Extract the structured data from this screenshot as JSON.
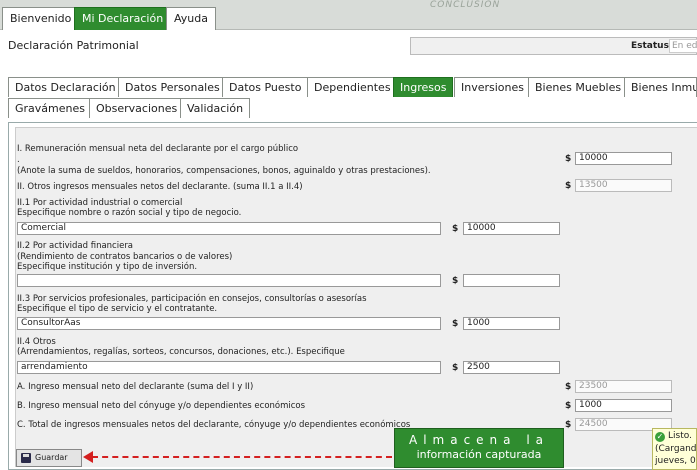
{
  "main_tabs": [
    {
      "label": "Bienvenido"
    },
    {
      "label": "Mi Declaración"
    },
    {
      "label": "Ayuda"
    }
  ],
  "header_deco": "CONCLUSIÓN",
  "page_title": "Declaración Patrimonial",
  "estatus": {
    "label": "Estatus",
    "value": "En edición"
  },
  "section_tabs": [
    {
      "label": "Datos Declaración"
    },
    {
      "label": "Datos Personales"
    },
    {
      "label": "Datos Puesto"
    },
    {
      "label": "Dependientes"
    },
    {
      "label": "Ingresos"
    },
    {
      "label": "Inversiones"
    },
    {
      "label": "Bienes Muebles"
    },
    {
      "label": "Bienes Inmuebles"
    },
    {
      "label": "Gravámenes"
    },
    {
      "label": "Observaciones"
    },
    {
      "label": "Validación"
    }
  ],
  "currency_symbol": "$",
  "form": {
    "I": {
      "label1": "I. Remuneración mensual neta del declarante por el cargo público",
      "label2": ".",
      "label3": "(Anote la suma de sueldos, honorarios, compensaciones, bonos, aguinaldo y otras prestaciones).",
      "value": "10000"
    },
    "II": {
      "label": "II. Otros ingresos mensuales netos del declarante. (suma II.1 a II.4)",
      "value": "13500"
    },
    "II1": {
      "label1": "II.1 Por actividad industrial o comercial",
      "label2": "Especifique nombre o razón social y tipo de negocio.",
      "text": "Comercial",
      "value": "10000"
    },
    "II2": {
      "label1": "II.2 Por actividad financiera",
      "label2": "(Rendimiento de contratos bancarios o de valores)",
      "label3": "Especifique institución y tipo de inversión.",
      "text": "",
      "value": ""
    },
    "II3": {
      "label1": "II.3 Por servicios profesionales, participación en consejos, consultorías o asesorías",
      "label2": "Especifique el tipo de servicio y el contratante.",
      "text": "ConsultorÃas",
      "value": "1000"
    },
    "II4": {
      "label1": "II.4 Otros",
      "label2": "(Arrendamientos, regalías, sorteos, concursos, donaciones, etc.). Especifique",
      "text": "arrendamiento",
      "value": "2500"
    },
    "A": {
      "label": "A. Ingreso mensual neto del declarante (suma del I y II)",
      "value": "23500"
    },
    "B": {
      "label": "B. Ingreso mensual neto del cónyuge y/o dependientes económicos",
      "value": "1000"
    },
    "C": {
      "label": "C. Total de ingresos mensuales netos del declarante, cónyuge y/o dependientes económicos",
      "value": "24500"
    }
  },
  "save_button": "Guardar",
  "tooltip": {
    "line1": "Almacena la",
    "line2": "información capturada"
  },
  "notice": {
    "line1": "Listo.",
    "line2": "(Cargando",
    "line3": "jueves, 0"
  },
  "colors": {
    "accent": "#2f8c2f",
    "arrow": "#d42020",
    "notice_bg": "#ffffd8"
  }
}
